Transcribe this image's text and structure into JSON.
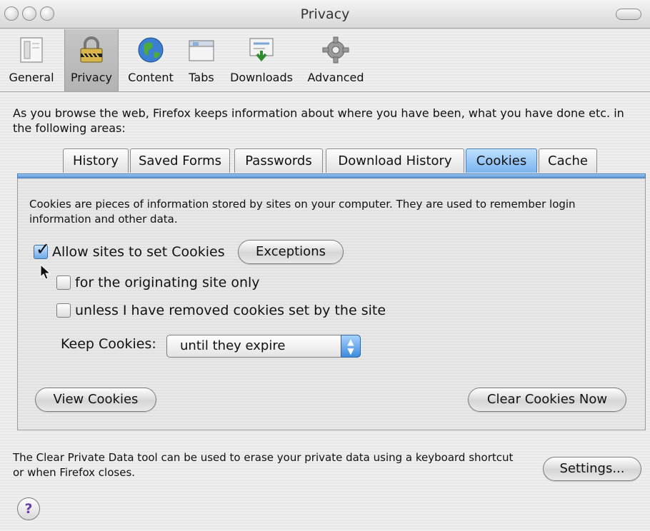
{
  "window": {
    "title": "Privacy"
  },
  "toolbar": {
    "items": [
      {
        "label": "General",
        "icon": "general-icon"
      },
      {
        "label": "Privacy",
        "icon": "privacy-lock-icon",
        "selected": true
      },
      {
        "label": "Content",
        "icon": "globe-icon"
      },
      {
        "label": "Tabs",
        "icon": "tabs-window-icon"
      },
      {
        "label": "Downloads",
        "icon": "downloads-icon"
      },
      {
        "label": "Advanced",
        "icon": "gear-icon"
      }
    ]
  },
  "intro_text": "As you browse the web, Firefox keeps information about where you have been, what you have done etc. in the following areas:",
  "tabs": [
    {
      "label": "History"
    },
    {
      "label": "Saved Forms"
    },
    {
      "label": "Passwords"
    },
    {
      "label": "Download History"
    },
    {
      "label": "Cookies",
      "active": true
    },
    {
      "label": "Cache"
    }
  ],
  "cookies": {
    "description": "Cookies are pieces of information stored by sites on your computer. They are used to remember login information and other data.",
    "allow_label": "Allow sites to set Cookies",
    "allow_checked": true,
    "exceptions_label": "Exceptions",
    "originating_label": "for the originating site only",
    "originating_checked": false,
    "unless_label": "unless I have removed cookies set by the site",
    "unless_checked": false,
    "keep_label": "Keep Cookies:",
    "keep_value": "until they expire",
    "view_label": "View Cookies",
    "clear_label": "Clear Cookies Now"
  },
  "footer": {
    "text": "The Clear Private Data tool can be used to erase your private data using a keyboard shortcut or when Firefox closes.",
    "settings_label": "Settings...",
    "help_label": "?"
  },
  "colors": {
    "accent": "#5b95d2",
    "selected_tab": "#79b4ef"
  }
}
